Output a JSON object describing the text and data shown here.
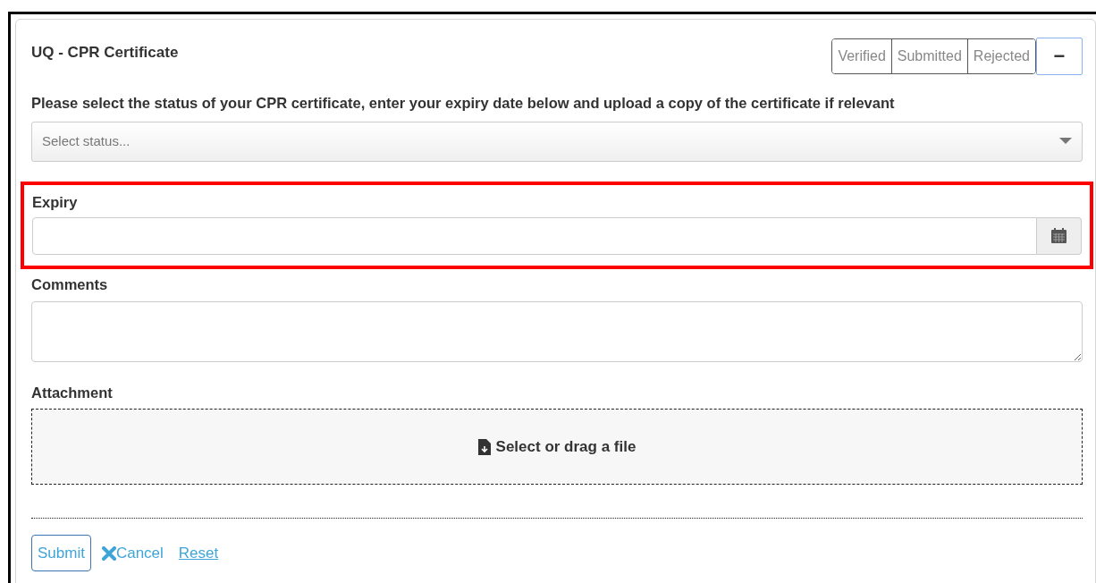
{
  "card": {
    "title": "UQ - CPR Certificate",
    "status_buttons": [
      {
        "label": "Verified",
        "selected": false
      },
      {
        "label": "Submitted",
        "selected": false
      },
      {
        "label": "Rejected",
        "selected": false
      }
    ],
    "collapse_button": {
      "label": "−"
    },
    "instruction": "Please select the status of your CPR certificate, enter your expiry date below and upload a copy of the certificate if relevant",
    "status_select": {
      "placeholder": "Select status..."
    },
    "expiry": {
      "label": "Expiry",
      "highlighted": true
    },
    "comments": {
      "label": "Comments"
    },
    "attachment": {
      "label": "Attachment",
      "dropzone": "Select or drag a file"
    },
    "actions": {
      "submit": "Submit",
      "cancel": "Cancel",
      "reset": "Reset"
    }
  }
}
